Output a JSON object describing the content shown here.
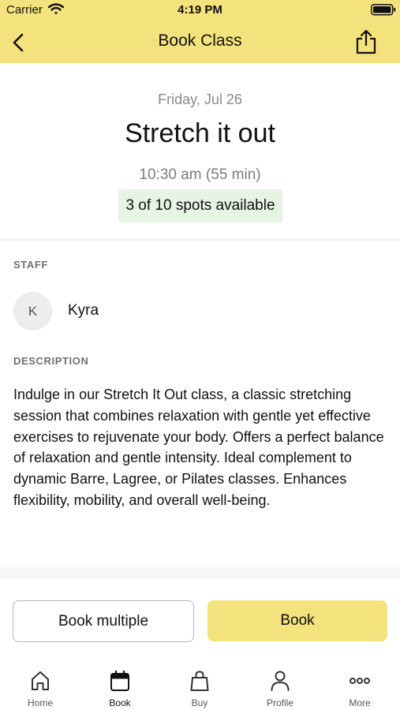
{
  "status_bar": {
    "carrier": "Carrier",
    "time": "4:19 PM"
  },
  "nav": {
    "title": "Book Class",
    "back_icon": "chevron-left-icon",
    "share_icon": "share-icon"
  },
  "class_info": {
    "date": "Friday, Jul 26",
    "name": "Stretch it out",
    "time": "10:30 am (55 min)",
    "spots": "3 of 10 spots available"
  },
  "staff": {
    "label": "STAFF",
    "initial": "K",
    "name": "Kyra"
  },
  "description": {
    "label": "DESCRIPTION",
    "text": "Indulge in our Stretch It Out class, a classic stretching session that combines relaxation with gentle yet effective exercises to rejuvenate your body. Offers a perfect balance of relaxation and gentle intensity. Ideal complement to dynamic Barre, Lagree, or Pilates classes. Enhances flexibility, mobility, and overall well-being."
  },
  "actions": {
    "book_multiple": "Book multiple",
    "book": "Book"
  },
  "tabs": [
    {
      "label": "Home",
      "icon": "home-icon"
    },
    {
      "label": "Book",
      "icon": "calendar-icon",
      "active": true
    },
    {
      "label": "Buy",
      "icon": "shopping-bag-icon"
    },
    {
      "label": "Profile",
      "icon": "person-icon"
    },
    {
      "label": "More",
      "icon": "more-dots-icon"
    }
  ],
  "colors": {
    "accent": "#f4e27c",
    "badge_bg": "#e6f4e4",
    "muted_text": "#8a8a8a"
  }
}
